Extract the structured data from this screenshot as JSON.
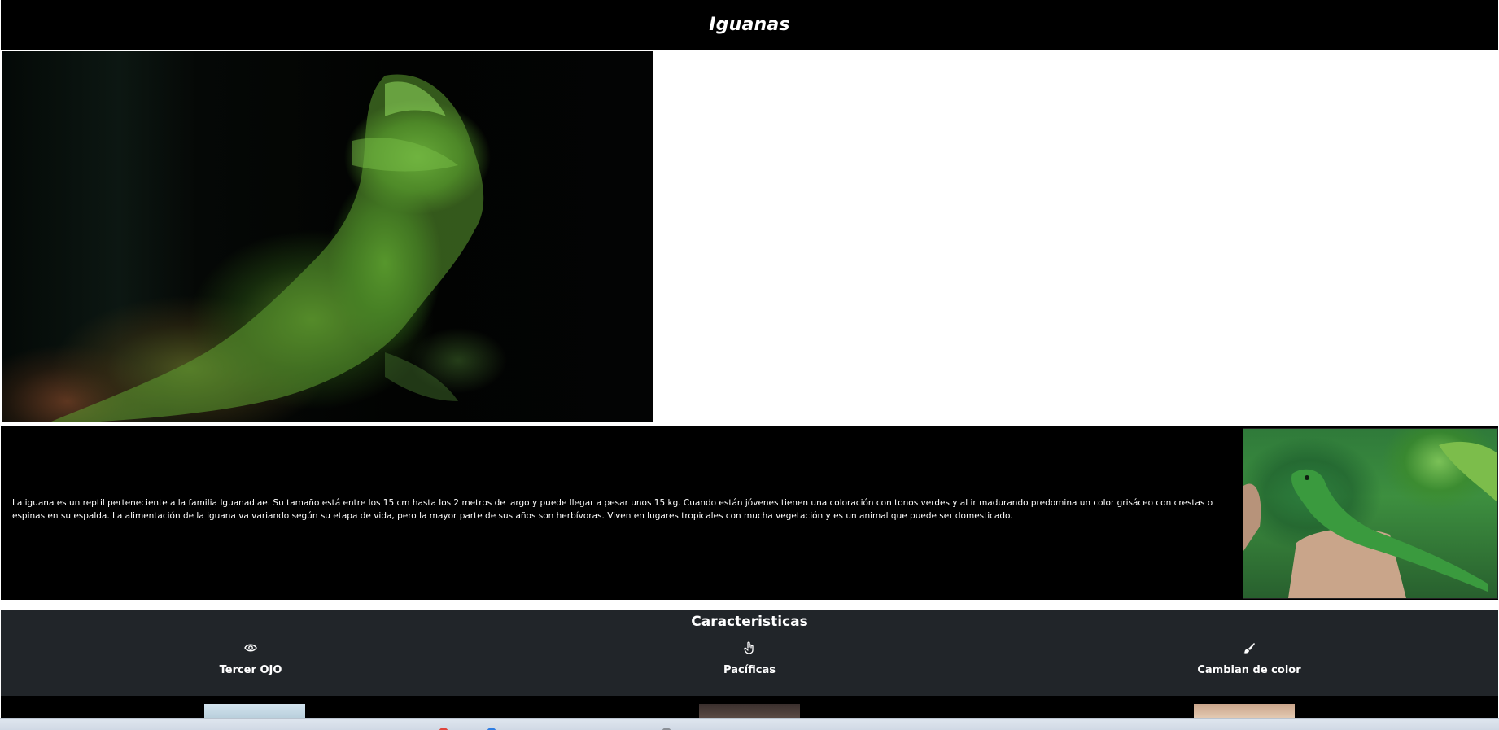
{
  "header": {
    "title": "Iguanas"
  },
  "hero": {
    "image": "bearded-dragon-photo"
  },
  "info": {
    "text": "La iguana es un reptil perteneciente a la familia Iguanadiae. Su tamaño está entre los 15 cm hasta los 2 metros de largo y puede llegar a pesar unos 15 kg. Cuando están jóvenes tienen una coloración con tonos verdes y al ir madurando predomina un color grisáceo con crestas o espinas en su espalda. La alimentación de la iguana va variando según su etapa de vida, pero la mayor parte de sus años son herbívoras. Viven en lugares tropicales con mucha vegetación y es un animal que puede ser domesticado.",
    "image": "green-iguana-photo"
  },
  "features": {
    "title": "Caracteristicas",
    "items": [
      {
        "icon": "eye-icon",
        "label": "Tercer OJO"
      },
      {
        "icon": "hand-pointer-icon",
        "label": "Pacíficas"
      },
      {
        "icon": "paintbrush-icon",
        "label": "Cambian de color"
      }
    ]
  },
  "colors": {
    "header_bg": "#000000",
    "features_bg": "#212529",
    "text": "#ffffff"
  }
}
